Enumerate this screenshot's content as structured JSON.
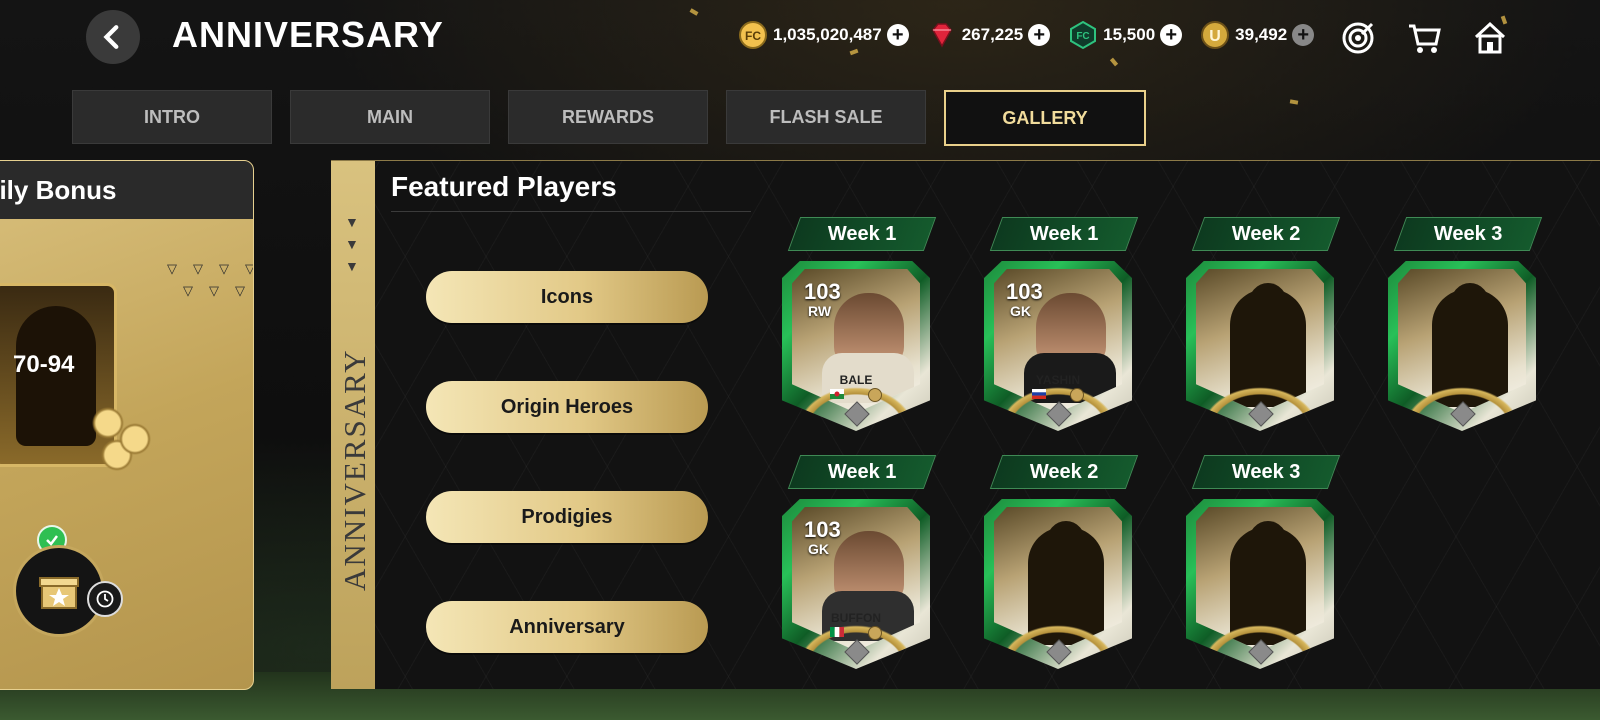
{
  "header": {
    "back_label": "Back",
    "title": "ANNIVERSARY",
    "currencies": [
      {
        "value": "1,035,020,487",
        "icon": "fc-coin-icon",
        "color": "#f2c14e"
      },
      {
        "value": "267,225",
        "icon": "ruby-gem-icon",
        "color": "#e0243b"
      },
      {
        "value": "15,500",
        "icon": "fc-points-icon",
        "color": "#2ec27e"
      },
      {
        "value": "39,492",
        "icon": "u-token-icon",
        "color": "#d4a93c"
      }
    ],
    "icons": [
      "objectives-target-icon",
      "store-cart-icon",
      "home-icon"
    ]
  },
  "tabs": [
    {
      "label": "INTRO"
    },
    {
      "label": "MAIN"
    },
    {
      "label": "REWARDS"
    },
    {
      "label": "FLASH SALE"
    },
    {
      "label": "GALLERY"
    }
  ],
  "active_tab": "GALLERY",
  "daily_bonus": {
    "title": "aily Bonus",
    "pack_range": "70-94",
    "claimed": true
  },
  "ribbon": {
    "text": "ANNIVERSARY"
  },
  "featured": {
    "title": "Featured Players",
    "categories": [
      {
        "label": "Icons"
      },
      {
        "label": "Origin Heroes"
      },
      {
        "label": "Prodigies"
      },
      {
        "label": "Anniversary"
      }
    ],
    "cards": [
      {
        "week": "Week 1",
        "rating": "103",
        "position": "RW",
        "name": "BALE",
        "revealed": true
      },
      {
        "week": "Week 1",
        "rating": "103",
        "position": "GK",
        "name": "YASHIN",
        "revealed": true
      },
      {
        "week": "Week 2",
        "revealed": false
      },
      {
        "week": "Week 3",
        "revealed": false
      },
      {
        "week": "Week 1",
        "rating": "103",
        "position": "GK",
        "name": "BUFFON",
        "revealed": true
      },
      {
        "week": "Week 2",
        "revealed": false
      },
      {
        "week": "Week 3",
        "revealed": false
      }
    ]
  },
  "colors": {
    "accent_gold": "#e9d08a",
    "card_green": "#1d8a3c"
  }
}
